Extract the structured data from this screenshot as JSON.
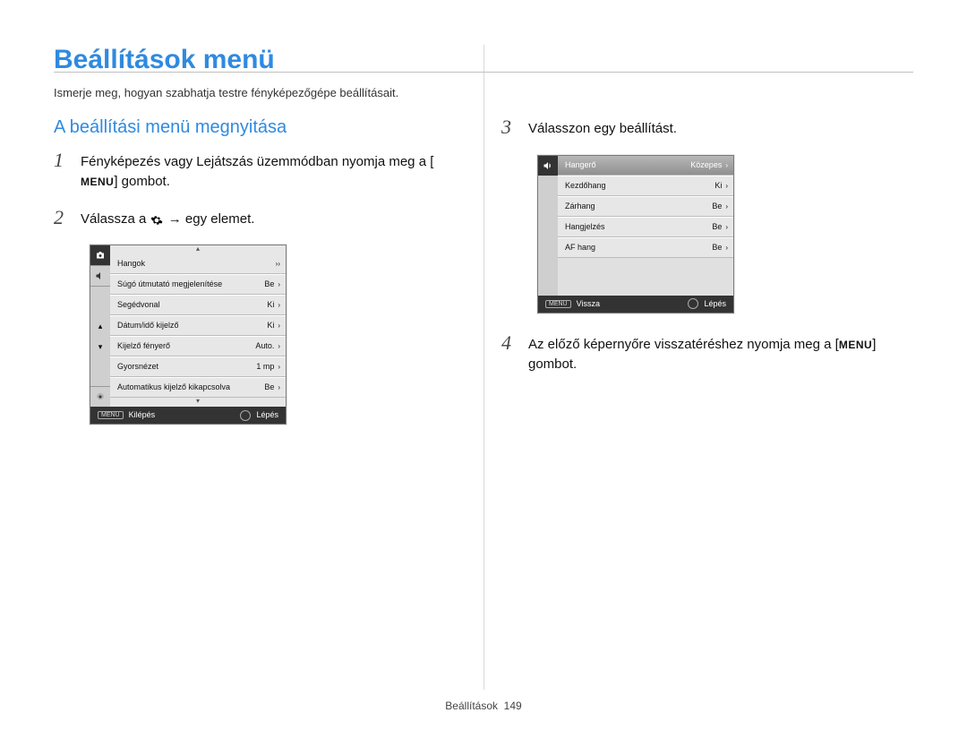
{
  "page_title": "Beállítások menü",
  "subtitle": "Ismerje meg, hogyan szabhatja testre fényképezőgépe beállításait.",
  "left": {
    "heading": "A beállítási menü megnyitása",
    "step1": {
      "num": "1",
      "pre": "Fényképezés vagy Lejátszás üzemmódban nyomja meg a [",
      "menu": "MENU",
      "post": "] gombot."
    },
    "step2": {
      "num": "2",
      "pre": "Válassza a ",
      "post": " → egy elemet."
    },
    "device": {
      "rows": [
        {
          "label": "Hangok",
          "value": "",
          "chev": "››"
        },
        {
          "label": "Súgó útmutató megjelenítése",
          "value": "Be",
          "chev": "›"
        },
        {
          "label": "Segédvonal",
          "value": "Ki",
          "chev": "›"
        },
        {
          "label": "Dátum/idő kijelző",
          "value": "Ki",
          "chev": "›"
        },
        {
          "label": "Kijelző fényerő",
          "value": "Auto.",
          "chev": "›"
        },
        {
          "label": "Gyorsnézet",
          "value": "1 mp",
          "chev": "›"
        },
        {
          "label": "Automatikus kijelző kikapcsolva",
          "value": "Be",
          "chev": "›"
        }
      ],
      "footer_left": "Kilépés",
      "footer_left_badge": "MENU",
      "footer_right": "Lépés"
    }
  },
  "right": {
    "step3": {
      "num": "3",
      "text": "Válasszon egy beállítást."
    },
    "device": {
      "rows": [
        {
          "label": "Hangerő",
          "value": "Közepes",
          "chev": "›",
          "selected": true
        },
        {
          "label": "Kezdőhang",
          "value": "Ki",
          "chev": "›"
        },
        {
          "label": "Zárhang",
          "value": "Be",
          "chev": "›"
        },
        {
          "label": "Hangjelzés",
          "value": "Be",
          "chev": "›"
        },
        {
          "label": "AF hang",
          "value": "Be",
          "chev": "›"
        }
      ],
      "footer_left": "Vissza",
      "footer_left_badge": "MENU",
      "footer_right": "Lépés"
    },
    "step4": {
      "num": "4",
      "pre": "Az előző képernyőre visszatéréshez nyomja meg a [",
      "menu": "MENU",
      "post": "] gombot."
    }
  },
  "footer": {
    "section": "Beállítások",
    "page": "149"
  }
}
